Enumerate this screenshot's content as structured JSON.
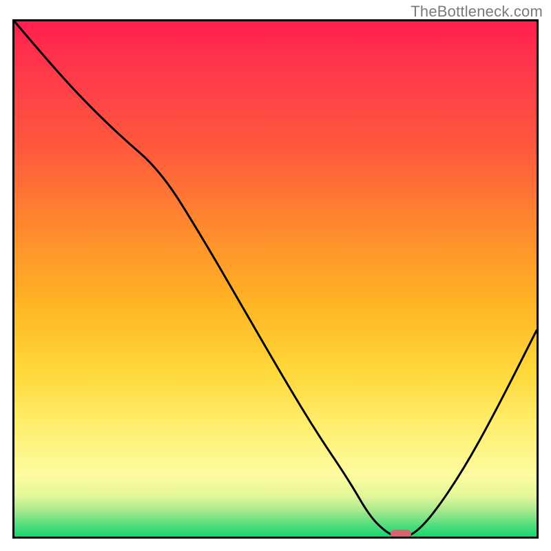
{
  "watermark": "TheBottleneck.com",
  "chart_data": {
    "type": "line",
    "title": "",
    "xlabel": "",
    "ylabel": "",
    "xlim": [
      0,
      100
    ],
    "ylim": [
      0,
      100
    ],
    "background": "rainbow-vertical",
    "series": [
      {
        "name": "bottleneck-curve",
        "x": [
          0,
          5,
          12,
          20,
          28,
          36,
          44,
          52,
          58,
          64,
          68,
          71,
          73,
          76,
          80,
          86,
          92,
          100
        ],
        "y": [
          100,
          94,
          86,
          78,
          71,
          58,
          44,
          30,
          20,
          11,
          4,
          1,
          0,
          0,
          4,
          13,
          24,
          40
        ]
      }
    ],
    "marker": {
      "x": 74,
      "y": 0.5,
      "color": "#d8646e"
    },
    "grid": false,
    "legend": false
  }
}
